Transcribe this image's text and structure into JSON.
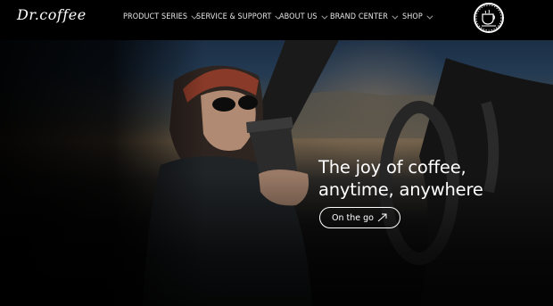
{
  "brand": {
    "logo_text": "Dr.coffee"
  },
  "nav": [
    {
      "label": "PRODUCT SERIES"
    },
    {
      "label": "SERVICE & SUPPORT"
    },
    {
      "label": "ABOUT US"
    },
    {
      "label": "BRAND CENTER"
    },
    {
      "label": "SHOP"
    }
  ],
  "hero": {
    "headline_line1": "The joy of coffee,",
    "headline_line2": "anytime, anywhere",
    "cta_label": "On the go"
  },
  "icons": {
    "nav_chevron": "chevron-down-icon",
    "search": "search-icon",
    "cta_arrow": "arrow-up-right-icon",
    "badge": "coffee-cup-badge-icon"
  },
  "colors": {
    "background": "#000000",
    "text": "#ffffff"
  }
}
